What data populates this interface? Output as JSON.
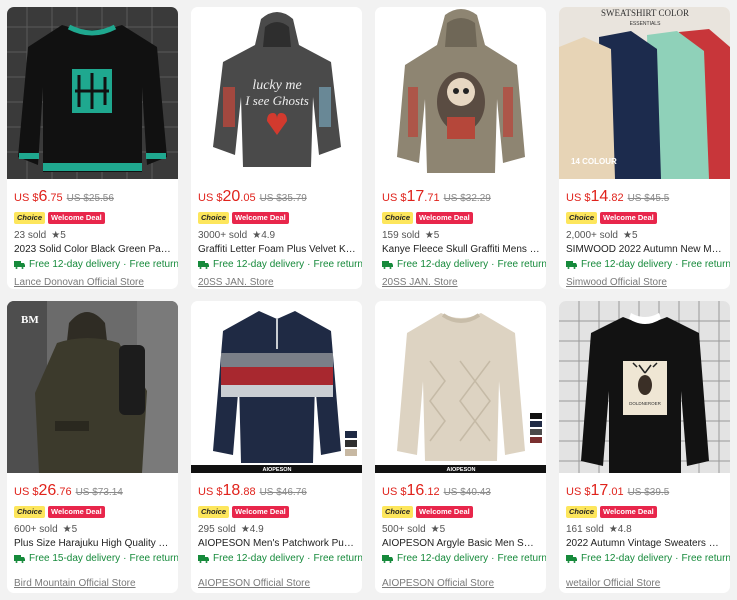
{
  "products": [
    {
      "currency": "US $",
      "price_int": "6",
      "price_dec": ".75",
      "orig": "US $25.56",
      "choice": "Choice",
      "deal": "Welcome Deal",
      "sold": "23 sold",
      "rating": "5",
      "title": "2023 Solid Color Black Green Patc...",
      "delivery": "Free 12-day delivery",
      "return": "Free return",
      "store": "Lance Donovan Official Store",
      "image_icon": "black-green-sweater-image"
    },
    {
      "currency": "US $",
      "price_int": "20",
      "price_dec": ".05",
      "orig": "US $35.79",
      "choice": "Choice",
      "deal": "Welcome Deal",
      "sold": "3000+ sold",
      "rating": "4.9",
      "title": "Graffiti Letter Foam Plus Velvet Ka...",
      "delivery": "Free 12-day delivery",
      "return": "Free return",
      "store": "20SS JAN. Store",
      "image_icon": "grey-hoodie-image",
      "image_text": [
        "lucky me",
        "I see Ghosts"
      ]
    },
    {
      "currency": "US $",
      "price_int": "17",
      "price_dec": ".71",
      "orig": "US $32.29",
      "choice": "Choice",
      "deal": "Welcome Deal",
      "sold": "159 sold",
      "rating": "5",
      "title": "Kanye Fleece Skull Graffiti Mens S...",
      "delivery": "Free 12-day delivery",
      "return": "Free return",
      "store": "20SS JAN. Store",
      "image_icon": "khaki-skull-hoodie-image"
    },
    {
      "currency": "US $",
      "price_int": "14",
      "price_dec": ".82",
      "orig": "US $45.5",
      "choice": "Choice",
      "deal": "Welcome Deal",
      "sold": "2,000+ sold",
      "rating": "5",
      "title": "SIMWOOD 2022 Autumn New Men...",
      "delivery": "Free 12-day delivery",
      "return": "Free return",
      "store": "Simwood Official Store",
      "image_icon": "colored-sweatshirts-image",
      "image_text": [
        "SWEATSHIRT COLOR",
        "ESSENTIALS",
        "14 COLOUR"
      ]
    },
    {
      "currency": "US $",
      "price_int": "26",
      "price_dec": ".76",
      "orig": "US $73.14",
      "choice": "Choice",
      "deal": "Welcome Deal",
      "sold": "600+ sold",
      "rating": "5",
      "title": "Plus Size Harajuku High Quality Th...",
      "delivery": "Free 15-day delivery",
      "return": "Free return",
      "store": "Bird Mountain Official Store",
      "image_icon": "olive-hoodie-model-image",
      "image_text": [
        "BM"
      ]
    },
    {
      "currency": "US $",
      "price_int": "18",
      "price_dec": ".88",
      "orig": "US $46.76",
      "choice": "Choice",
      "deal": "Welcome Deal",
      "sold": "295 sold",
      "rating": "4.9",
      "title": "AIOPESON Men's Patchwork Pullo...",
      "delivery": "Free 12-day delivery",
      "return": "Free return",
      "store": "AIOPESON Official Store",
      "image_icon": "striped-zip-pullover-image",
      "image_text": [
        "AIOPESON"
      ]
    },
    {
      "currency": "US $",
      "price_int": "16",
      "price_dec": ".12",
      "orig": "US $40.43",
      "choice": "Choice",
      "deal": "Welcome Deal",
      "sold": "500+ sold",
      "rating": "5",
      "title": "AIOPESON Argyle Basic Men Sweat...",
      "delivery": "Free 12-day delivery",
      "return": "Free return",
      "store": "AIOPESON Official Store",
      "image_icon": "beige-cable-sweater-image",
      "image_text": [
        "AIOPESON"
      ]
    },
    {
      "currency": "US $",
      "price_int": "17",
      "price_dec": ".01",
      "orig": "US $39.5",
      "choice": "Choice",
      "deal": "Welcome Deal",
      "sold": "161 sold",
      "rating": "4.8",
      "title": "2022 Autumn Vintage Sweaters Ov...",
      "delivery": "Free 12-day delivery",
      "return": "Free return",
      "store": "wetailor Official Store",
      "image_icon": "deer-sweater-image",
      "image_text": [
        "DOLDNEROER"
      ]
    }
  ],
  "colors": {
    "price": "#e0231c",
    "choice_bg": "#fde65c",
    "deal_bg": "#e8264b",
    "delivery": "#168a3b"
  }
}
